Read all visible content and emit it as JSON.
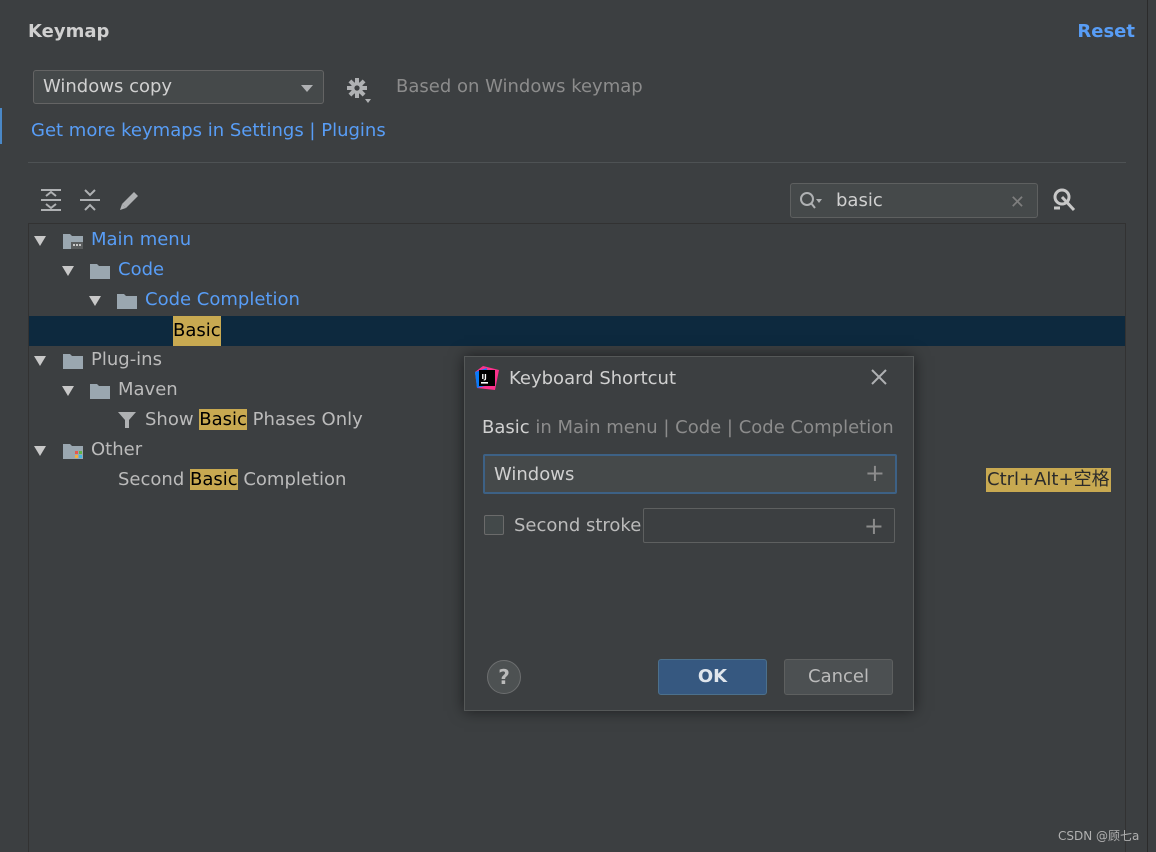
{
  "header": {
    "title": "Keymap",
    "reset_label": "Reset"
  },
  "keymap": {
    "selected": "Windows copy",
    "based_on": "Based on Windows keymap",
    "more_link": "Get more keymaps in Settings | Plugins"
  },
  "search": {
    "value": "basic"
  },
  "tree": {
    "main_menu": "Main menu",
    "code": "Code",
    "code_completion": "Code Completion",
    "basic": "Basic",
    "plugins": "Plug-ins",
    "maven": "Maven",
    "show_pre": "Show ",
    "show_hl": "Basic",
    "show_post": " Phases Only",
    "other": "Other",
    "second_pre": "Second ",
    "second_hl": "Basic",
    "second_post": " Completion",
    "second_shortcut": "Ctrl+Alt+空格"
  },
  "dialog": {
    "title": "Keyboard Shortcut",
    "action": "Basic",
    "path": " in Main menu | Code | Code Completion",
    "first_stroke": "Windows",
    "second_label": "Second stroke:",
    "second_value": "",
    "help_label": "?",
    "ok_label": "OK",
    "cancel_label": "Cancel"
  },
  "watermark": "CSDN @顾七a",
  "colors": {
    "background": "#3c3f41",
    "link": "#589df6",
    "selection": "#0d293e",
    "highlight": "#c8a951",
    "ok_button": "#365880"
  },
  "icons": {
    "settings": "gear-icon",
    "expand": "expand-all-icon",
    "collapse": "collapse-all-icon",
    "edit": "pencil-icon",
    "search": "search-icon",
    "find_shortcut": "find-by-shortcut-icon",
    "folder": "folder-icon",
    "filter": "filter-icon",
    "app": "intellij-logo-icon",
    "close": "close-icon"
  }
}
